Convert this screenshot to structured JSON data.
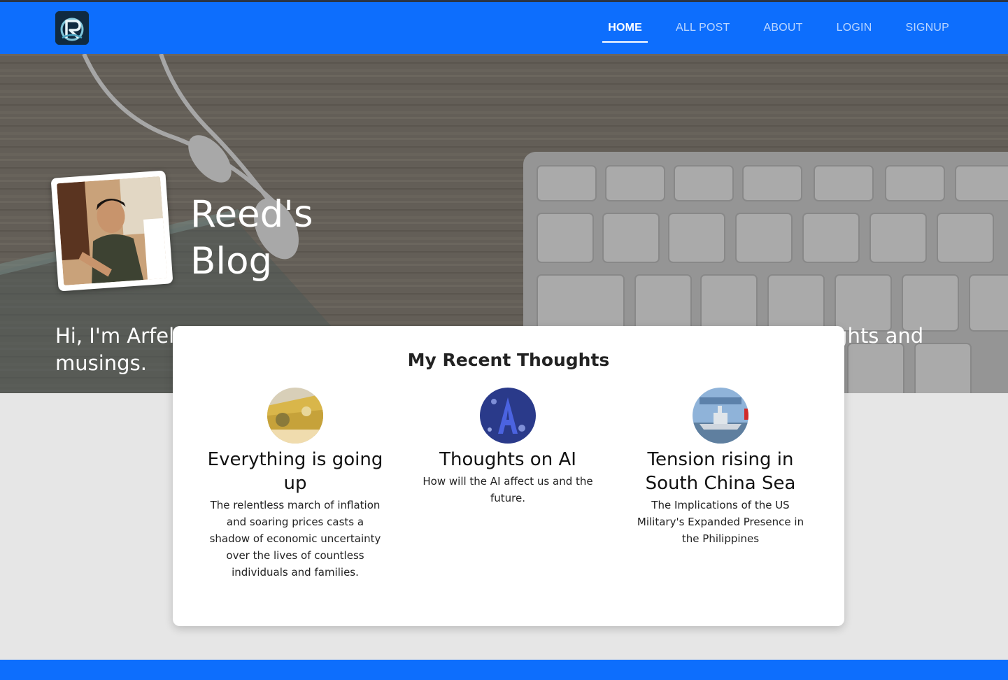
{
  "nav": {
    "logo_icon": "brand-logo-icon",
    "links": [
      {
        "label": "HOME",
        "active": true
      },
      {
        "label": "ALL POST",
        "active": false
      },
      {
        "label": "ABOUT",
        "active": false
      },
      {
        "label": "LOGIN",
        "active": false
      },
      {
        "label": "SIGNUP",
        "active": false
      }
    ]
  },
  "hero": {
    "title_line1": "Reed's",
    "title_line2": "Blog",
    "intro": "Hi, I'm Arfelo Reed. Welcome, this is a collection of some of my random thoughts and musings."
  },
  "recent": {
    "heading": "My Recent Thoughts",
    "posts": [
      {
        "title": "Everything is going up",
        "description": "The relentless march of inflation and soaring prices casts a shadow of economic uncertainty over the lives of countless individuals and families.",
        "thumb_icon": "money-bills-image"
      },
      {
        "title": "Thoughts on AI",
        "description": "How will the AI affect us and the future.",
        "thumb_icon": "ai-letter-a-image"
      },
      {
        "title": "Tension rising in South China Sea",
        "description": "The Implications of the US Military's Expanded Presence in the Philippines",
        "thumb_icon": "warship-image"
      }
    ]
  },
  "colors": {
    "primary": "#0d6efd",
    "page_background": "#e6e6e6",
    "card_background": "#ffffff"
  }
}
